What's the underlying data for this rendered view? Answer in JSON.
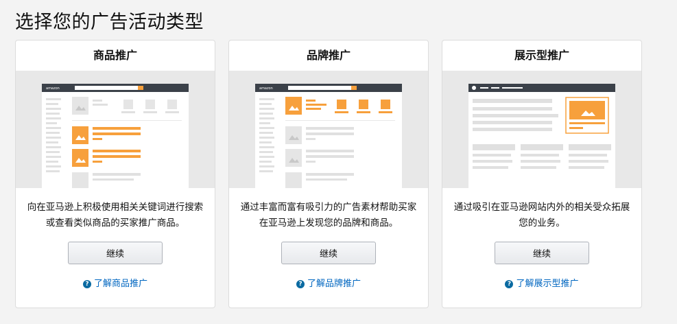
{
  "page_title": "选择您的广告活动类型",
  "cards": [
    {
      "title": "商品推广",
      "description": "向在亚马逊上积极使用相关关键词进行搜索或查看类似商品的买家推广商品。",
      "button": "继续",
      "link": "了解商品推广",
      "logo_text": "amazon"
    },
    {
      "title": "品牌推广",
      "description": "通过丰富而富有吸引力的广告素材帮助买家在亚马逊上发现您的品牌和商品。",
      "button": "继续",
      "link": "了解品牌推广",
      "logo_text": "amazon"
    },
    {
      "title": "展示型推广",
      "description": "通过吸引在亚马逊网站内外的相关受众拓展您的业务。",
      "button": "继续",
      "link": "了解展示型推广"
    }
  ],
  "colors": {
    "accent_orange": "#f7a03c",
    "link_blue": "#0066c0",
    "mock_header": "#3b4149"
  },
  "icons": [
    "help-circle-icon",
    "image-placeholder-icon"
  ]
}
